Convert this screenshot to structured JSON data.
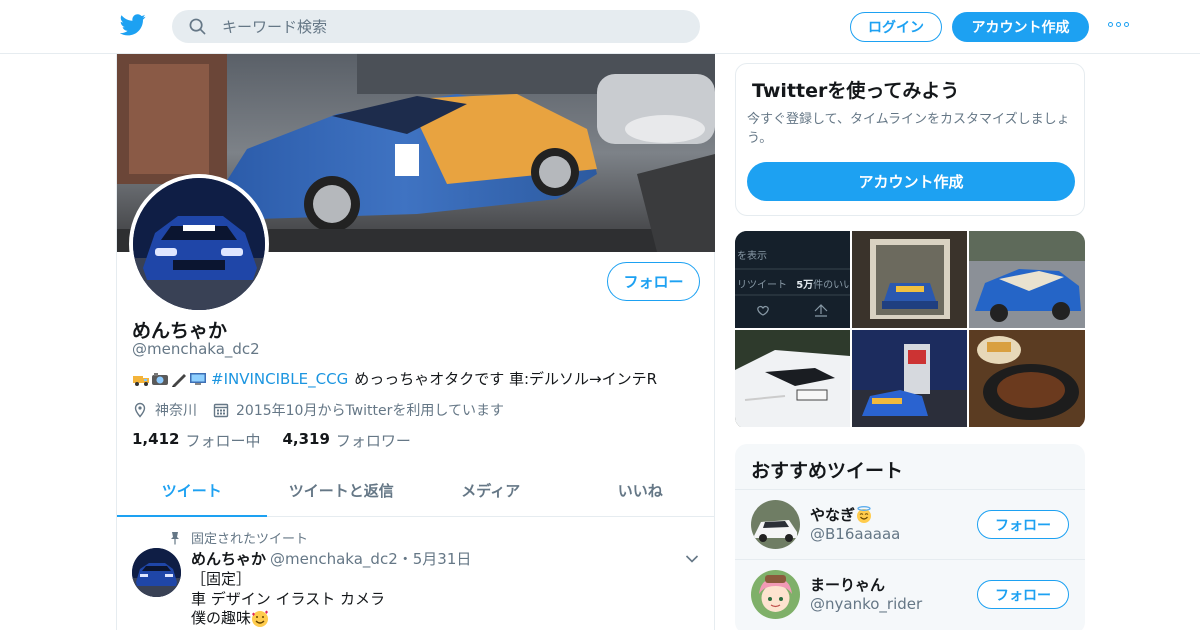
{
  "colors": {
    "accent": "#1da1f2",
    "link": "#1b95e0",
    "muted": "#657786",
    "border": "#e6ecf0",
    "panel": "#f5f8fa"
  },
  "header": {
    "logo_icon": "twitter-bird-icon",
    "search": {
      "placeholder": "キーワード検索",
      "icon": "search-icon"
    },
    "login_label": "ログイン",
    "signup_label": "アカウント作成",
    "more_icon": "more-dots-icon"
  },
  "profile": {
    "follow_label": "フォロー",
    "name": "めんちゃか",
    "handle": "@menchaka_dc2",
    "bio": {
      "emoji_icons": [
        "truck-emoji",
        "camera-emoji",
        "pen-emoji",
        "computer-emoji"
      ],
      "hashtag": "#INVINCIBLE_CCG",
      "text": "めっっちゃオタクです 車:デルソル→インテR"
    },
    "location": "神奈川",
    "joined": "2015年10月からTwitterを利用しています",
    "following_count": "1,412",
    "following_label": "フォロー中",
    "followers_count": "4,319",
    "followers_label": "フォロワー",
    "tabs": [
      "ツイート",
      "ツイートと返信",
      "メディア",
      "いいね"
    ],
    "active_tab": 0
  },
  "pinned_tweet": {
    "pinned_label": "固定されたツイート",
    "author_name": "めんちゃか",
    "author_handle_date": "@menchaka_dc2・5月31日",
    "lines": [
      "［固定］",
      "車 デザイン イラスト カメラ",
      "僕の趣味"
    ],
    "emoji": "smiling-hearts-emoji"
  },
  "signup_card": {
    "title": "Twitterを使ってみよう",
    "text": "今すぐ登録して、タイムラインをカスタマイズしましょう。",
    "cta_label": "アカウント作成"
  },
  "media": {
    "screenshot_text": {
      "show": "を表示",
      "retweets": "リツイート",
      "likes_count": "5万",
      "likes_label": "件のいいね"
    }
  },
  "recommended": {
    "title": "おすすめツイート",
    "accounts": [
      {
        "name": "やなぎ",
        "emoji": "halo-smile-emoji",
        "handle": "@B16aaaaa",
        "follow_label": "フォロー"
      },
      {
        "name": "まーりゃん",
        "handle": "@nyanko_rider",
        "follow_label": "フォロー"
      }
    ]
  }
}
